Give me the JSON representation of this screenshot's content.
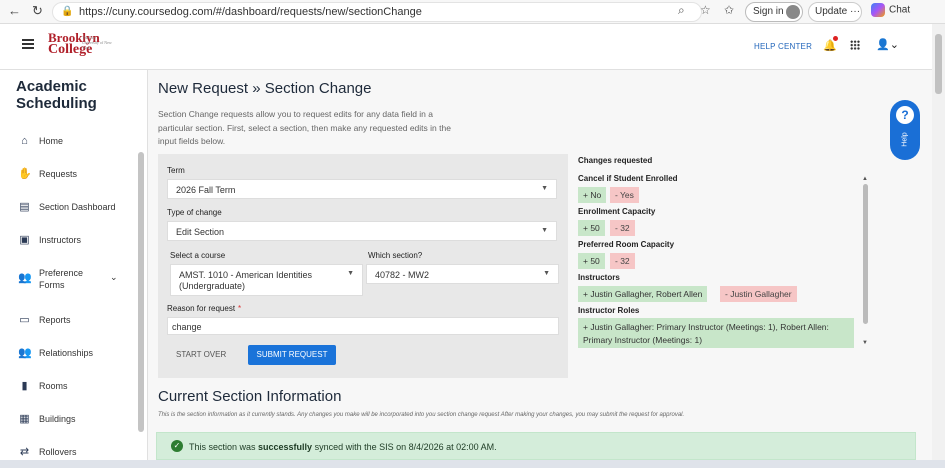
{
  "browser": {
    "url": "https://cuny.coursedog.com/#/dashboard/requests/new/sectionChange",
    "sign_in": "Sign in",
    "update": "Update",
    "chat": "Chat"
  },
  "header": {
    "brand_line1": "Brooklyn",
    "brand_line2": "College",
    "brand_sub": "The City University of New York",
    "help_center": "HELP CENTER"
  },
  "sidebar": {
    "title": "Academic Scheduling",
    "items": [
      {
        "label": "Home",
        "icon": "home-icon"
      },
      {
        "label": "Requests",
        "icon": "requests-icon"
      },
      {
        "label": "Section Dashboard",
        "icon": "dashboard-icon"
      },
      {
        "label": "Instructors",
        "icon": "instructors-icon"
      },
      {
        "label": "Preference Forms",
        "icon": "preference-forms-icon"
      },
      {
        "label": "Reports",
        "icon": "reports-icon"
      },
      {
        "label": "Relationships",
        "icon": "relationships-icon"
      },
      {
        "label": "Rooms",
        "icon": "rooms-icon"
      },
      {
        "label": "Buildings",
        "icon": "buildings-icon"
      },
      {
        "label": "Rollovers",
        "icon": "rollovers-icon"
      }
    ]
  },
  "main": {
    "title_part1": "New Request",
    "title_sep": "»",
    "title_part2": "Section Change",
    "description": "Section Change requests allow you to request edits for any data field in a particular section. First, select a section, then make any requested edits in the input fields below.",
    "form": {
      "term_label": "Term",
      "term_value": "2026 Fall Term",
      "type_label": "Type of change",
      "type_value": "Edit Section",
      "course_label": "Select a course",
      "course_value": "AMST. 1010 - American Identities (Undergraduate)",
      "section_label": "Which section?",
      "section_value": "40782 - MW2",
      "reason_label": "Reason for request",
      "reason_required": "*",
      "reason_value": "change",
      "start_over": "START OVER",
      "submit": "SUBMIT REQUEST"
    },
    "changes": {
      "title": "Changes requested",
      "cancel_label": "Cancel if Student Enrolled",
      "cancel_add": "+ No",
      "cancel_rem": "- Yes",
      "enroll_label": "Enrollment Capacity",
      "enroll_add": "+ 50",
      "enroll_rem": "- 32",
      "room_label": "Preferred Room Capacity",
      "room_add": "+ 50",
      "room_rem": "- 32",
      "instr_label": "Instructors",
      "instr_add": "+ Justin Gallagher, Robert Allen",
      "instr_rem": "- Justin Gallagher",
      "roles_label": "Instructor Roles",
      "roles_add": "+ Justin Gallagher: Primary Instructor (Meetings: 1), Robert Allen: Primary Instructor (Meetings: 1)"
    },
    "current": {
      "title": "Current Section Information",
      "description": "This is the section information as it currently stands. Any changes you make will be incorporated into you section change request After making your changes, you may submit the request for approval.",
      "sync_pre": "This section was ",
      "sync_bold": "successfully",
      "sync_post": " synced with the SIS on 8/4/2026 at 02:00 AM."
    }
  },
  "help_fab": {
    "label": "Help",
    "glyph": "?"
  }
}
